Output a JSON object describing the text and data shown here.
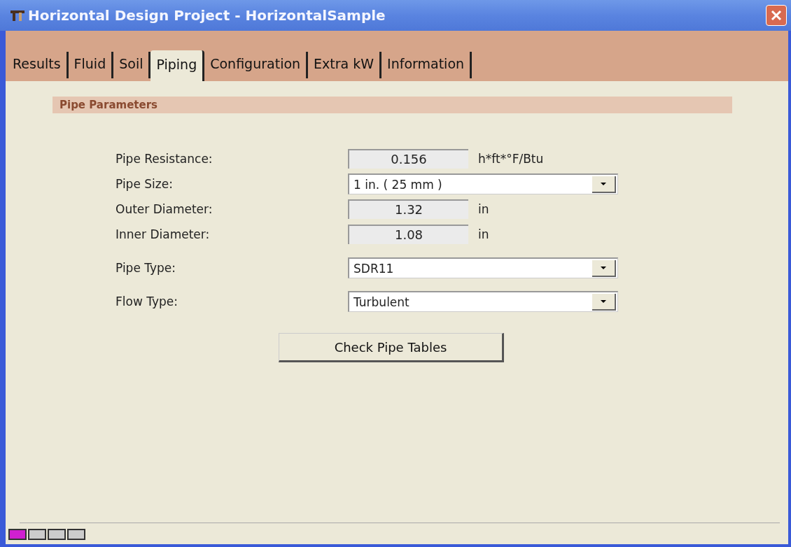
{
  "window": {
    "title": "Horizontal Design Project - HorizontalSample"
  },
  "tabs": [
    {
      "label": "Results",
      "selected": false
    },
    {
      "label": "Fluid",
      "selected": false
    },
    {
      "label": "Soil",
      "selected": false
    },
    {
      "label": "Piping",
      "selected": true
    },
    {
      "label": "Configuration",
      "selected": false
    },
    {
      "label": "Extra kW",
      "selected": false
    },
    {
      "label": "Information",
      "selected": false
    }
  ],
  "section": {
    "title": "Pipe Parameters"
  },
  "fields": [
    {
      "kind": "readonly",
      "label": "Pipe Resistance:",
      "value": "0.156",
      "unit": "h*ft*°F/Btu"
    },
    {
      "kind": "dropdown",
      "label": "Pipe Size:",
      "value": "1 in. ( 25 mm )"
    },
    {
      "kind": "readonly",
      "label": "Outer Diameter:",
      "value": "1.32",
      "unit": "in"
    },
    {
      "kind": "readonly",
      "label": "Inner Diameter:",
      "value": "1.08",
      "unit": "in"
    },
    {
      "kind": "dropdown",
      "label": "Pipe Type:",
      "value": "SDR11"
    },
    {
      "kind": "dropdown",
      "label": "Flow Type:",
      "value": "Turbulent"
    }
  ],
  "button": {
    "label": "Check Pipe Tables"
  },
  "pages": [
    {
      "selected": true
    },
    {
      "selected": false
    },
    {
      "selected": false
    },
    {
      "selected": false
    }
  ]
}
